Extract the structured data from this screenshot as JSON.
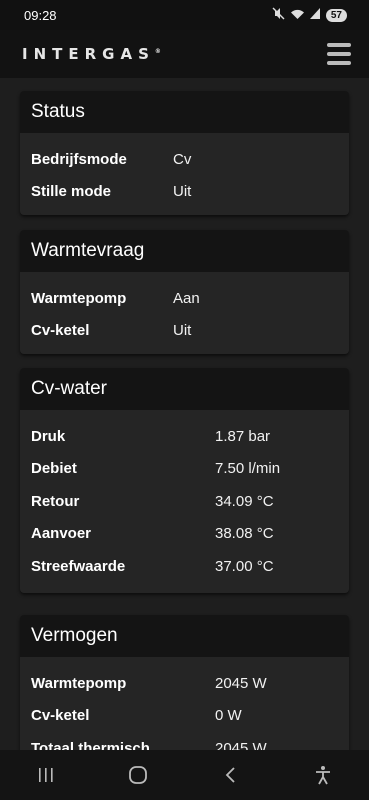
{
  "status_bar": {
    "time": "09:28",
    "battery": "57"
  },
  "app": {
    "logo": "INTERGAS",
    "logo_mark": "®"
  },
  "cards": [
    {
      "title": "Status",
      "rows": [
        {
          "label": "Bedrijfsmode",
          "value": "Cv"
        },
        {
          "label": "Stille mode",
          "value": "Uit"
        }
      ]
    },
    {
      "title": "Warmtevraag",
      "rows": [
        {
          "label": "Warmtepomp",
          "value": "Aan"
        },
        {
          "label": "Cv-ketel",
          "value": "Uit"
        }
      ]
    },
    {
      "title": "Cv-water",
      "rows": [
        {
          "label": "Druk",
          "value": "1.87 bar"
        },
        {
          "label": "Debiet",
          "value": "7.50 l/min"
        },
        {
          "label": "Retour",
          "value": "34.09 °C"
        },
        {
          "label": "Aanvoer",
          "value": "38.08 °C"
        },
        {
          "label": "Streefwaarde",
          "value": "37.00 °C"
        }
      ]
    },
    {
      "title": "Vermogen",
      "rows": [
        {
          "label": "Warmtepomp",
          "value": "2045 W"
        },
        {
          "label": "Cv-ketel",
          "value": "0 W"
        },
        {
          "label": "Totaal thermisch",
          "value": "2045 W"
        }
      ]
    }
  ],
  "icons": {
    "menu": "hamburger-icon",
    "mute": "mute-icon",
    "wifi": "wifi-icon",
    "signal": "signal-icon",
    "nav_recents": "recents-icon",
    "nav_home": "home-icon",
    "nav_back": "back-icon",
    "nav_accessibility": "accessibility-icon"
  },
  "colors": {
    "background": "#1e1e1e",
    "card": "#252525",
    "card_header": "#141414",
    "text": "#ffffff"
  }
}
